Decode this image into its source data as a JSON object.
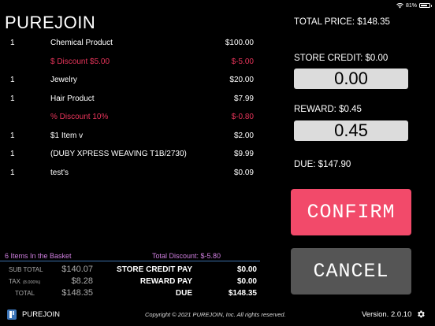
{
  "status": {
    "battery": "81%",
    "battery_level": 0.81
  },
  "app": {
    "title": "PUREJOIN"
  },
  "items": [
    {
      "qty": "1",
      "name": "Chemical Product",
      "price": "$100.00",
      "discount": false
    },
    {
      "qty": "",
      "name": "$ Discount $5.00",
      "price": "$-5.00",
      "discount": true
    },
    {
      "qty": "1",
      "name": "Jewelry",
      "price": "$20.00",
      "discount": false
    },
    {
      "qty": "1",
      "name": "Hair Product",
      "price": "$7.99",
      "discount": false
    },
    {
      "qty": "",
      "name": "% Discount 10%",
      "price": "$-0.80",
      "discount": true
    },
    {
      "qty": "1",
      "name": "$1 Item v",
      "price": "$2.00",
      "discount": false
    },
    {
      "qty": "1",
      "name": "(DUBY XPRESS WEAVING T1B/2730)",
      "price": "$9.99",
      "discount": false
    },
    {
      "qty": "1",
      "name": "test's",
      "price": "$0.09",
      "discount": false
    }
  ],
  "basket": {
    "count_label": "6 Items In the Basket",
    "total_discount": "Total Discount: $-5.80"
  },
  "totals": {
    "subtotal_label": "SUB TOTAL",
    "subtotal_value": "$140.07",
    "tax_label": "TAX",
    "tax_rate": "(8.000%)",
    "tax_value": "$8.28",
    "total_label": "TOTAL",
    "total_value": "$148.35",
    "store_credit_pay_label": "STORE CREDIT PAY",
    "store_credit_pay_value": "$0.00",
    "reward_pay_label": "REWARD PAY",
    "reward_pay_value": "$0.00",
    "due_label": "DUE",
    "due_value": "$148.35"
  },
  "payment": {
    "total_price": "TOTAL PRICE: $148.35",
    "store_credit_label": "STORE CREDIT: $0.00",
    "store_credit_input": "0.00",
    "reward_label": "REWARD: $0.45",
    "reward_input": "0.45",
    "due": "DUE: $147.90"
  },
  "buttons": {
    "confirm": "CONFIRM",
    "cancel": "CANCEL"
  },
  "footer": {
    "brand": "PUREJOIN",
    "copyright": "Copyright © 2021 PUREJOIN, Inc. All rights reserved.",
    "version": "Version. 2.0.10"
  },
  "colors": {
    "discount": "#e8345a",
    "basket_text": "#d07fe0",
    "confirm_bg": "#f24a6a",
    "cancel_bg": "#555555",
    "divider": "#3a6fa8",
    "logo": "#3b74b7"
  }
}
